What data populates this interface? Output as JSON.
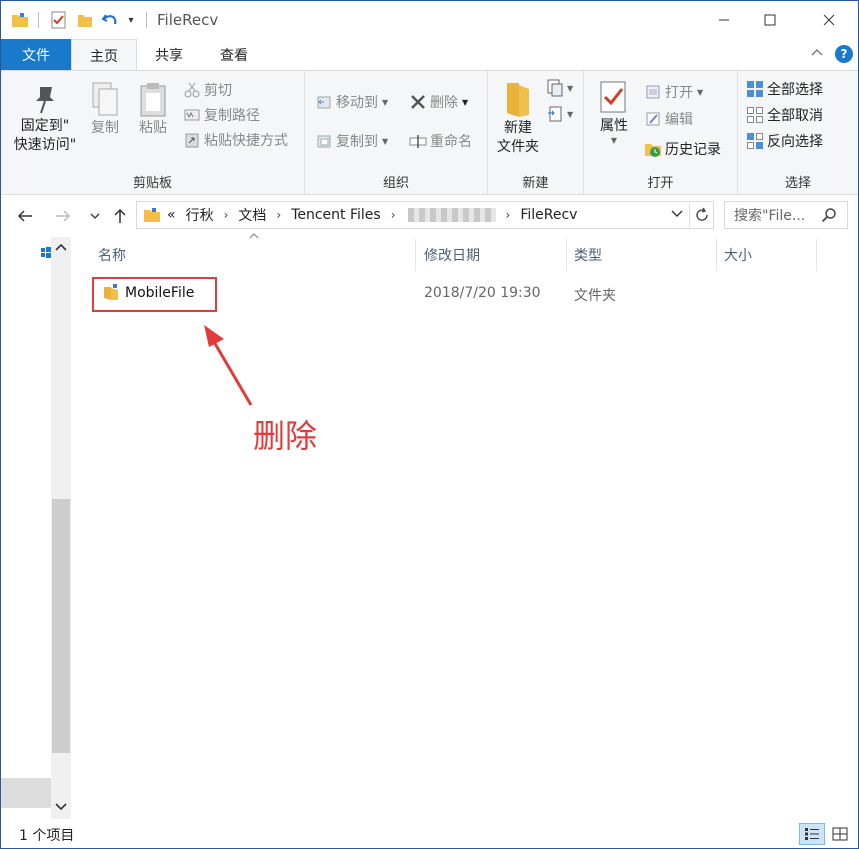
{
  "window": {
    "title": "FileRecv",
    "undo_dropdown_glyph": "▾"
  },
  "ribbon_tabs": {
    "file": "文件",
    "home": "主页",
    "share": "共享",
    "view": "查看"
  },
  "clipboard": {
    "pin_line1": "固定到\"",
    "pin_line2": "快速访问\"",
    "copy": "复制",
    "paste": "粘贴",
    "cut": "剪切",
    "copy_path": "复制路径",
    "paste_shortcut": "粘贴快捷方式",
    "label": "剪贴板"
  },
  "organize": {
    "move_to": "移动到",
    "copy_to": "复制到",
    "delete": "删除",
    "rename": "重命名",
    "label": "组织"
  },
  "new": {
    "new_folder_line1": "新建",
    "new_folder_line2": "文件夹",
    "label": "新建"
  },
  "open": {
    "properties": "属性",
    "open": "打开",
    "edit": "编辑",
    "history": "历史记录",
    "label": "打开"
  },
  "select": {
    "select_all": "全部选择",
    "select_none": "全部取消",
    "invert": "反向选择",
    "label": "选择"
  },
  "address": {
    "overflow": "«",
    "crumbs": [
      "行秋",
      "文档",
      "Tencent Files",
      "FileRecv"
    ],
    "search_placeholder": "搜索\"File..."
  },
  "columns": {
    "name": "名称",
    "date": "修改日期",
    "type": "类型",
    "size": "大小"
  },
  "files": [
    {
      "name": "MobileFile",
      "date": "2018/7/20 19:30",
      "type": "文件夹",
      "size": ""
    }
  ],
  "annotation": {
    "text": "删除",
    "color": "#e23b3b"
  },
  "status": {
    "count": "1 个项目"
  },
  "colors": {
    "accent": "#1979ca",
    "folder": "#f0c04a"
  }
}
